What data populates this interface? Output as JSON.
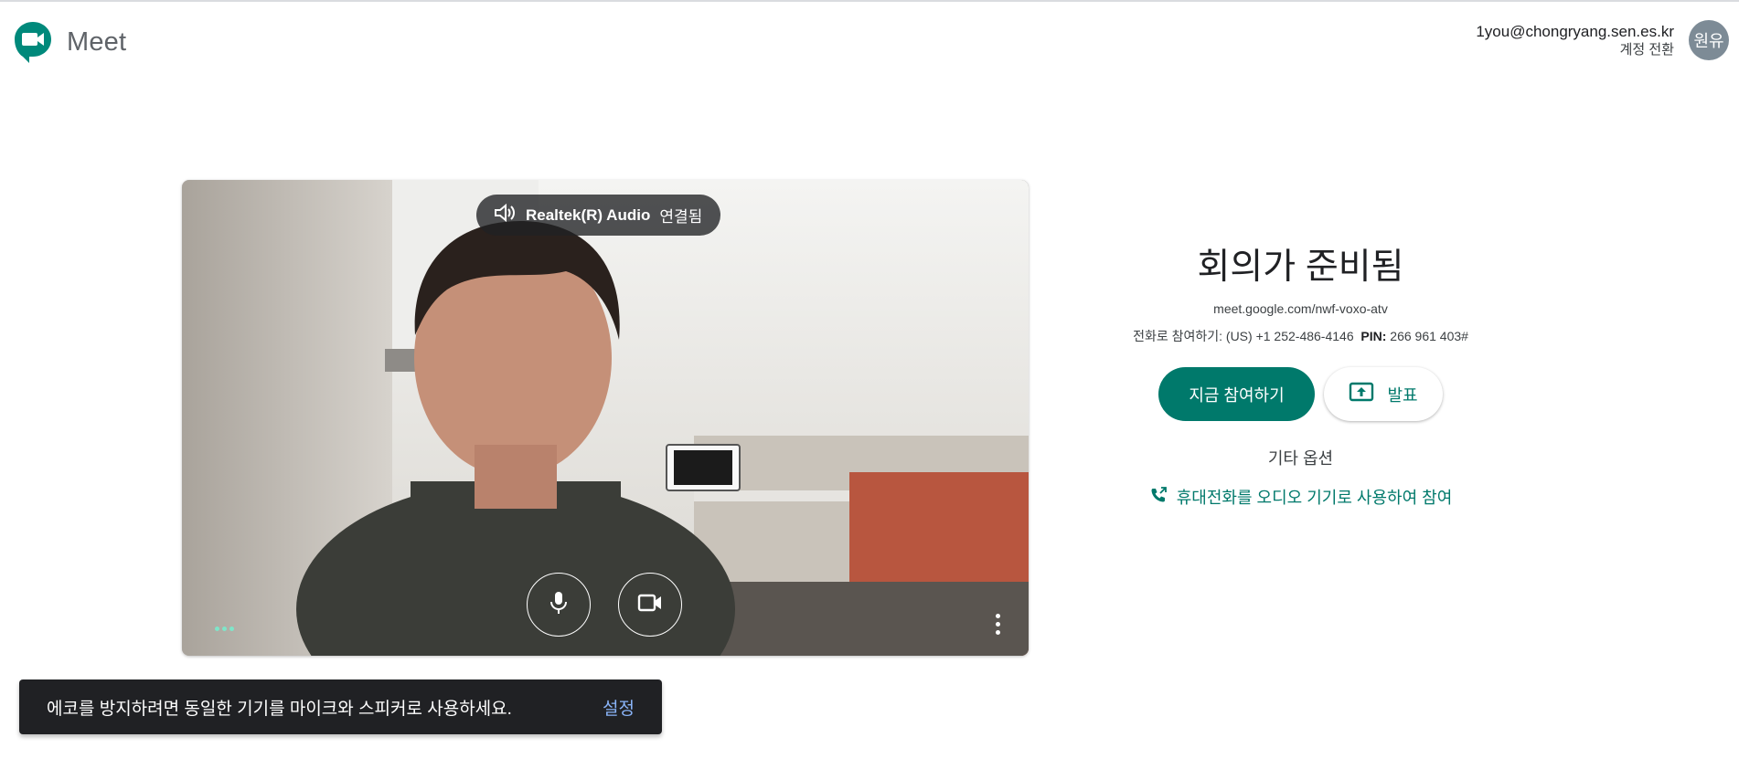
{
  "header": {
    "app_name": "Meet",
    "logo_icon": "meet-logo-icon",
    "account_email": "1you@chongryang.sen.es.kr",
    "switch_account": "계정 전환",
    "avatar_text": "원유"
  },
  "video": {
    "audio_device": "Realtek(R) Audio",
    "audio_status": "연결됨",
    "speaker_icon": "speaker-icon",
    "mic_icon": "microphone-icon",
    "camera_icon": "video-camera-icon",
    "more_icon": "more-vert-icon"
  },
  "panel": {
    "title": "회의가 준비됨",
    "meeting_link": "meet.google.com/nwf-voxo-atv",
    "phone_label": "전화로 참여하기:",
    "phone_number": "(US) +1 252-486-4146",
    "pin_label": "PIN:",
    "pin_value": "266 961 403#",
    "join_button": "지금 참여하기",
    "present_button": "발표",
    "other_options": "기타 옵션",
    "phone_audio": "휴대전화를 오디오 기기로 사용하여 참여"
  },
  "snackbar": {
    "message": "에코를 방지하려면 동일한 기기를 마이크와 스피커로 사용하세요.",
    "action": "설정"
  },
  "colors": {
    "accent": "#00796b",
    "snackbar_bg": "#202124",
    "snackbar_action": "#8ab4f8"
  }
}
